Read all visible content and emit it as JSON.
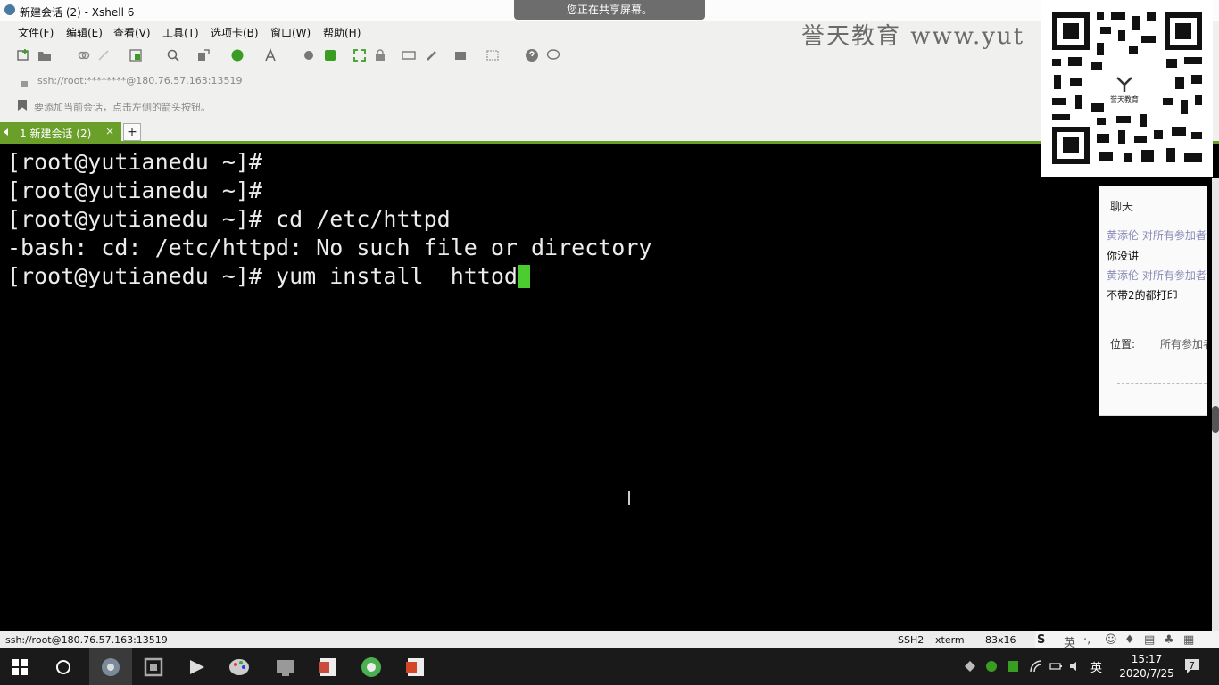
{
  "window": {
    "title": "新建会话 (2) - Xshell 6"
  },
  "share_banner": "您正在共享屏幕。",
  "watermark": "誉天教育 www.yut",
  "menu": [
    "文件(F)",
    "编辑(E)",
    "查看(V)",
    "工具(T)",
    "选项卡(B)",
    "窗口(W)",
    "帮助(H)"
  ],
  "address": "ssh://root:********@180.76.57.163:13519",
  "hint": "要添加当前会话，点击左侧的箭头按钮。",
  "tab": {
    "label": "1 新建会话 (2)",
    "close": "×",
    "add": "+"
  },
  "terminal": {
    "lines": [
      "[root@yutianedu ~]#",
      "[root@yutianedu ~]#",
      "[root@yutianedu ~]# cd /etc/httpd",
      "-bash: cd: /etc/httpd: No such file or directory",
      "[root@yutianedu ~]# yum install  httod"
    ],
    "cursor_color": "#4ccd2f"
  },
  "qr": {
    "logo_text": "誉天教育"
  },
  "chat": {
    "title": "聊天",
    "messages": [
      {
        "meta": "黄添伦 对所有参加者说:",
        "text": "你没讲"
      },
      {
        "meta": "黄添伦 对所有参加者说:",
        "text": "不带2的都打印"
      }
    ],
    "to_label": "位置:",
    "to_value": "所有参加者"
  },
  "status": {
    "connection": "ssh://root@180.76.57.163:13519",
    "protocol": "SSH2",
    "terminal_type": "xterm",
    "size": "83x16"
  },
  "ime": {
    "lang": "英"
  },
  "tray": {
    "lang": "英",
    "time": "15:17",
    "date": "2020/7/25",
    "notifications": "7"
  },
  "colors": {
    "tab_green": "#6aa02a",
    "terminal_bg": "#000000",
    "taskbar": "#1a1a1a"
  }
}
